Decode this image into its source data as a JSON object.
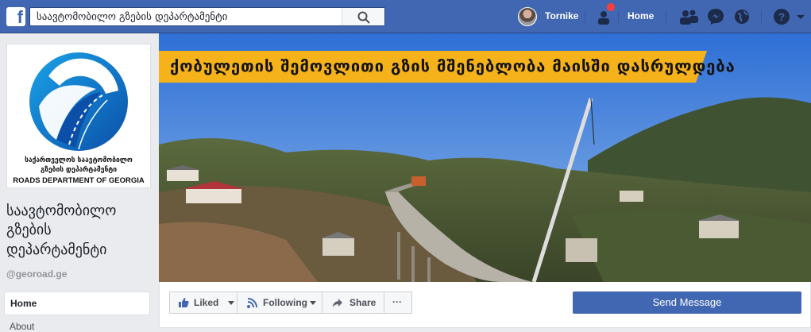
{
  "topbar": {
    "logo": "f",
    "search_value": "საავტომობილო გზების დეპარტამენტი",
    "search_icon": "search-icon",
    "user_name": "Tornike",
    "home_label": "Home",
    "icons": [
      "friend-requests-icon",
      "messenger-icon",
      "notifications-globe-icon",
      "help-icon"
    ],
    "accent": "#4267b2"
  },
  "page": {
    "logo_line1": "საქართველოს საავტომობილო",
    "logo_line2": "გზების დეპარტამენტი",
    "logo_line3": "ROADS DEPARTMENT OF GEORGIA",
    "name_line1": "საავტომობილო",
    "name_line2": "გზების",
    "name_line3": "დეპარტამენტი",
    "username": "@georoad.ge",
    "nav_home": "Home",
    "nav_about": "About"
  },
  "cover": {
    "banner_text": "ქობულეთის შემოვლითი გზის მშენებლობა მაისში დასრულდება"
  },
  "actions": {
    "liked": "Liked",
    "following": "Following",
    "share": "Share",
    "more": "···",
    "send_message": "Send Message"
  }
}
